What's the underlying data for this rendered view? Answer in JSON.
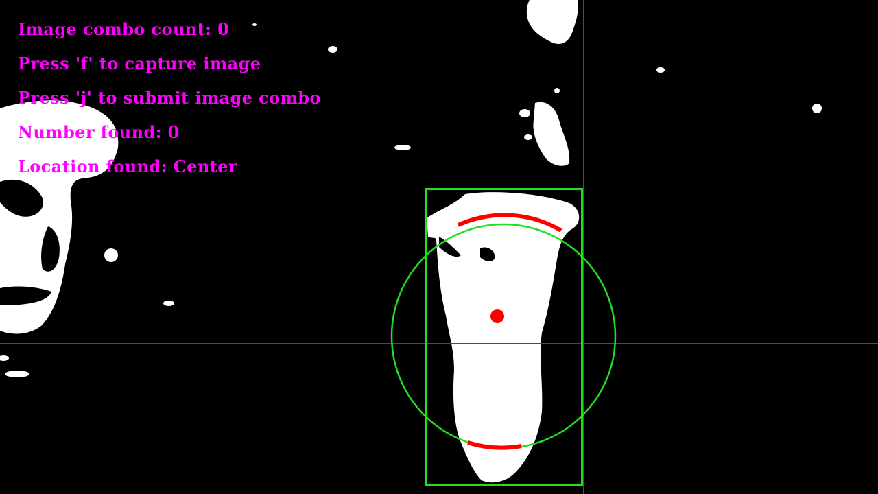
{
  "window": {
    "title": ""
  },
  "colors": {
    "hud_text": "#ff00ff",
    "grid_lines": "#ff0000",
    "bounding_box": "#22dd22",
    "fitted_circle": "#22dd22",
    "centroid_marker": "#ff0000",
    "arc_markers": "#ff0000",
    "mask_foreground": "#ffffff",
    "mask_background": "#000000"
  },
  "hud": {
    "lines": [
      "Image combo count: 0",
      "Press 'f' to capture image",
      "Press 'j' to submit image combo",
      "Number found: 0",
      "Location found: Center"
    ]
  },
  "overlay": {
    "icons": {
      "centroid": "centroid-dot-icon",
      "circle": "fitted-circle-icon",
      "box": "bounding-box-icon"
    }
  }
}
